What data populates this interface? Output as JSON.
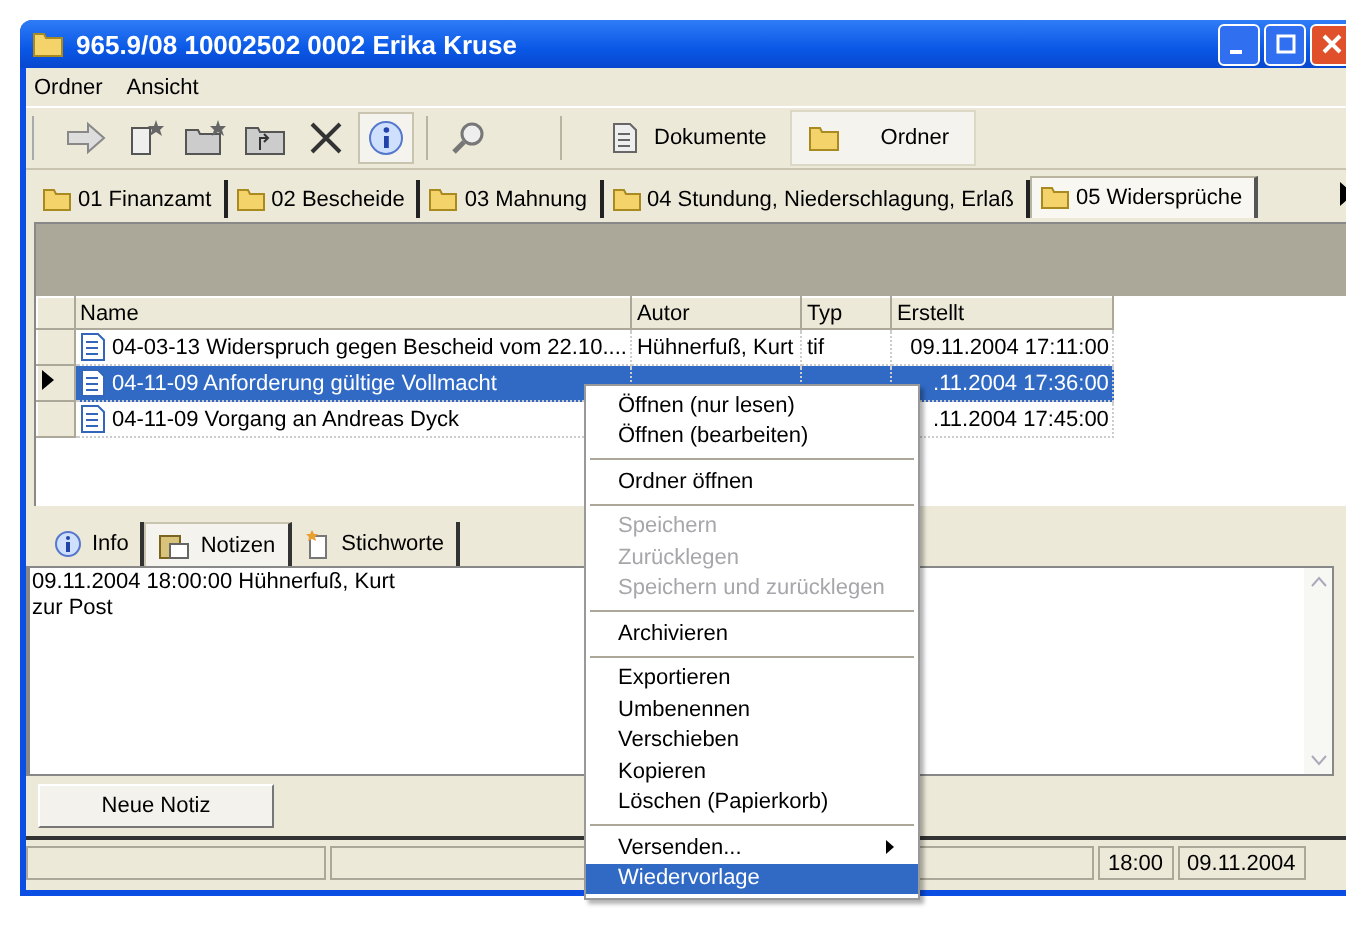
{
  "window": {
    "title": "965.9/08 10002502 0002 Erika Kruse"
  },
  "menubar": [
    "Ordner",
    "Ansicht"
  ],
  "toolbar": {
    "info_pressed": true,
    "views": [
      {
        "label": "Dokumente",
        "selected": false
      },
      {
        "label": "Ordner",
        "selected": true
      }
    ]
  },
  "folder_tabs": [
    {
      "label": "01 Finanzamt",
      "selected": false
    },
    {
      "label": "02 Bescheide",
      "selected": false
    },
    {
      "label": "03 Mahnung",
      "selected": false
    },
    {
      "label": "04 Stundung, Niederschlagung, Erlaß",
      "selected": false
    },
    {
      "label": "05 Widersprüche",
      "selected": true
    }
  ],
  "table": {
    "columns": [
      "Name",
      "Autor",
      "Typ",
      "Erstellt"
    ],
    "rows": [
      {
        "name": "04-03-13 Widerspruch gegen Bescheid vom 22.10....",
        "autor": "Hühnerfuß, Kurt",
        "typ": "tif",
        "erstellt": "09.11.2004 17:11:00",
        "selected": false
      },
      {
        "name": "04-11-09 Anforderung gültige Vollmacht",
        "erstellt": ".11.2004 17:36:00",
        "selected": true
      },
      {
        "name": "04-11-09 Vorgang an Andreas Dyck",
        "erstellt": ".11.2004 17:45:00",
        "selected": false
      }
    ]
  },
  "detail_tabs": [
    {
      "label": "Info",
      "selected": false
    },
    {
      "label": "Notizen",
      "selected": true
    },
    {
      "label": "Stichworte",
      "selected": false
    }
  ],
  "notes": {
    "lines": [
      "09.11.2004 18:00:00 Hühnerfuß, Kurt",
      "zur Post"
    ]
  },
  "new_note_button": "Neue Notiz",
  "status_bar": {
    "time": "18:00",
    "date": "09.11.2004"
  },
  "context_menu": [
    {
      "kind": "item",
      "label": "Öffnen (nur lesen)",
      "disabled": false,
      "selected": false
    },
    {
      "kind": "item",
      "label": "Öffnen (bearbeiten)",
      "disabled": false,
      "selected": false
    },
    {
      "kind": "separator"
    },
    {
      "kind": "item",
      "label": "Ordner öffnen",
      "disabled": false,
      "selected": false
    },
    {
      "kind": "separator"
    },
    {
      "kind": "item",
      "label": "Speichern",
      "disabled": true,
      "selected": false
    },
    {
      "kind": "item",
      "label": "Zurücklegen",
      "disabled": true,
      "selected": false
    },
    {
      "kind": "item",
      "label": "Speichern und zurücklegen",
      "disabled": true,
      "selected": false
    },
    {
      "kind": "separator"
    },
    {
      "kind": "item",
      "label": "Archivieren",
      "disabled": false,
      "selected": false
    },
    {
      "kind": "separator"
    },
    {
      "kind": "item",
      "label": "Exportieren",
      "disabled": false,
      "selected": false
    },
    {
      "kind": "item",
      "label": "Umbenennen",
      "disabled": false,
      "selected": false
    },
    {
      "kind": "item",
      "label": "Verschieben",
      "disabled": false,
      "selected": false
    },
    {
      "kind": "item",
      "label": "Kopieren",
      "disabled": false,
      "selected": false
    },
    {
      "kind": "item",
      "label": "Löschen (Papierkorb)",
      "disabled": false,
      "selected": false
    },
    {
      "kind": "separator"
    },
    {
      "kind": "submenu",
      "label": "Versenden...",
      "disabled": false,
      "selected": false
    },
    {
      "kind": "item",
      "label": "Wiedervorlage",
      "disabled": false,
      "selected": true
    }
  ]
}
